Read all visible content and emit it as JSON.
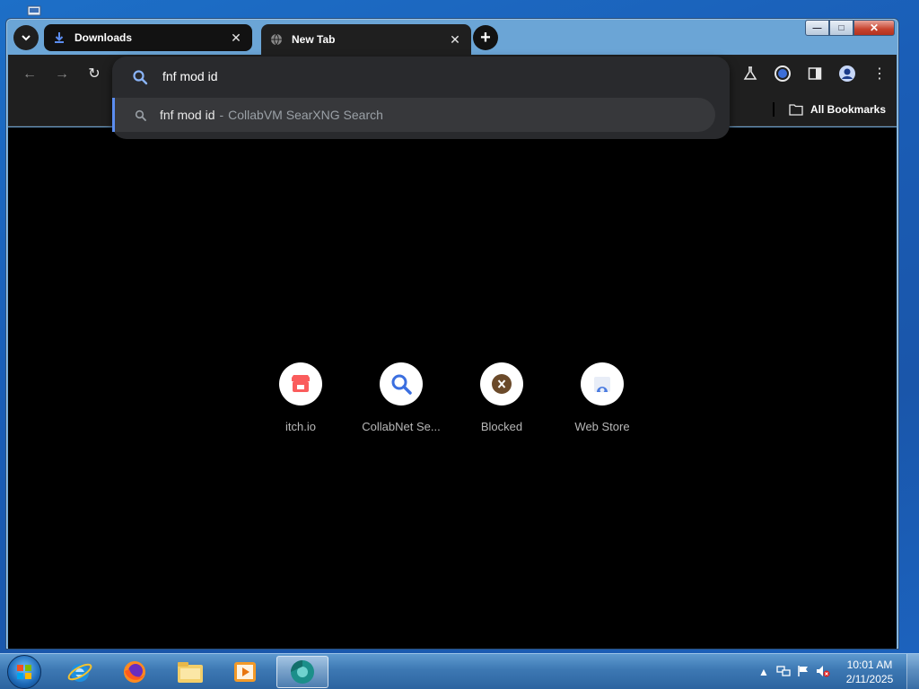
{
  "tabs": [
    {
      "title": "Downloads",
      "icon": "download-icon"
    },
    {
      "title": "New Tab",
      "icon": "globe-icon"
    }
  ],
  "omnibox": {
    "value": "fnf mod id",
    "suggestion": {
      "query": "fnf mod id",
      "separator": "-",
      "engine": "CollabVM SearXNG Search"
    }
  },
  "bookmarks": {
    "all_label": "All Bookmarks"
  },
  "shortcuts": [
    {
      "label": "itch.io",
      "icon": "itchio-icon"
    },
    {
      "label": "CollabNet Se...",
      "icon": "search-icon"
    },
    {
      "label": "Blocked",
      "icon": "blocked-x-icon"
    },
    {
      "label": "Web Store",
      "icon": "webstore-icon"
    }
  ],
  "taskbar": {
    "apps": [
      "internet-explorer-icon",
      "firefox-icon",
      "file-explorer-icon",
      "media-player-icon",
      "chromium-icon"
    ],
    "clock": {
      "time": "10:01 AM",
      "date": "2/11/2025"
    }
  },
  "colors": {
    "accent": "#5b8df0",
    "content_bg": "#000000",
    "toolbar_bg": "#1f1f1f",
    "omnibox_bg": "#292a2d"
  }
}
